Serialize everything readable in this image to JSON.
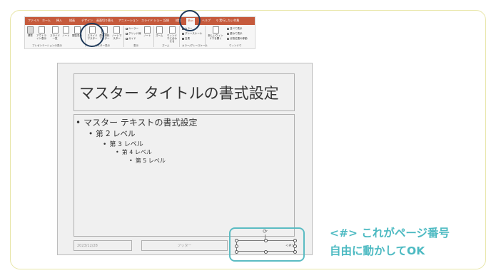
{
  "ribbon": {
    "tabs": [
      "ファイル",
      "ホーム",
      "挿入",
      "描画",
      "デザイン",
      "画面切り替え",
      "アニメーション",
      "スライド ショー",
      "記録",
      "校閲",
      "表示",
      "ヘルプ"
    ],
    "active_tab": "表示",
    "tell_me": "実行したい作業",
    "buttons": {
      "normal": "標準",
      "outline": "アウトライン表示",
      "sorter": "スライド一覧",
      "notes": "ノート",
      "reading": "閲覧表示",
      "slide_master": "スライドマスター",
      "handout_master": "配布資料マスター",
      "notes_master": "ノートマスター",
      "note": "ノート",
      "zoom": "ズーム",
      "fit": "ウィンドウに合わせる",
      "color": "カラー",
      "grayscale": "グレースケール",
      "bw": "白黒",
      "new_window": "新しいウィンドウを開く",
      "arrange_all": "並べて表示",
      "cascade": "重ねて表示",
      "move_split": "分割位置の移動"
    },
    "checks": [
      "ルーラー",
      "グリッド線",
      "ガイド"
    ],
    "groups": [
      "プレゼンテーションの表示",
      "マスター表示",
      "表示",
      "ズーム",
      "カラー/グレースケール",
      "ウィンドウ"
    ]
  },
  "slide": {
    "title": "マスター タイトルの書式設定",
    "levels": [
      {
        "bullet": "•",
        "text": "マスター テキストの書式設定"
      },
      {
        "bullet": "•",
        "text": "第 2 レベル"
      },
      {
        "bullet": "•",
        "text": "第 3 レベル"
      },
      {
        "bullet": "•",
        "text": "第 4 レベル"
      },
      {
        "bullet": "•",
        "text": "第 5 レベル"
      }
    ],
    "date": "2023/12/28",
    "footer": "フッター",
    "page_number": "<#>"
  },
  "callout": {
    "line1": "<#> これがページ番号",
    "line2": "自由に動かしてOK"
  },
  "colors": {
    "tab_bar": "#c55a3c",
    "highlight_circle": "#1f3a5a",
    "teal": "#4dbac2",
    "card_border": "#e8e6a8"
  }
}
